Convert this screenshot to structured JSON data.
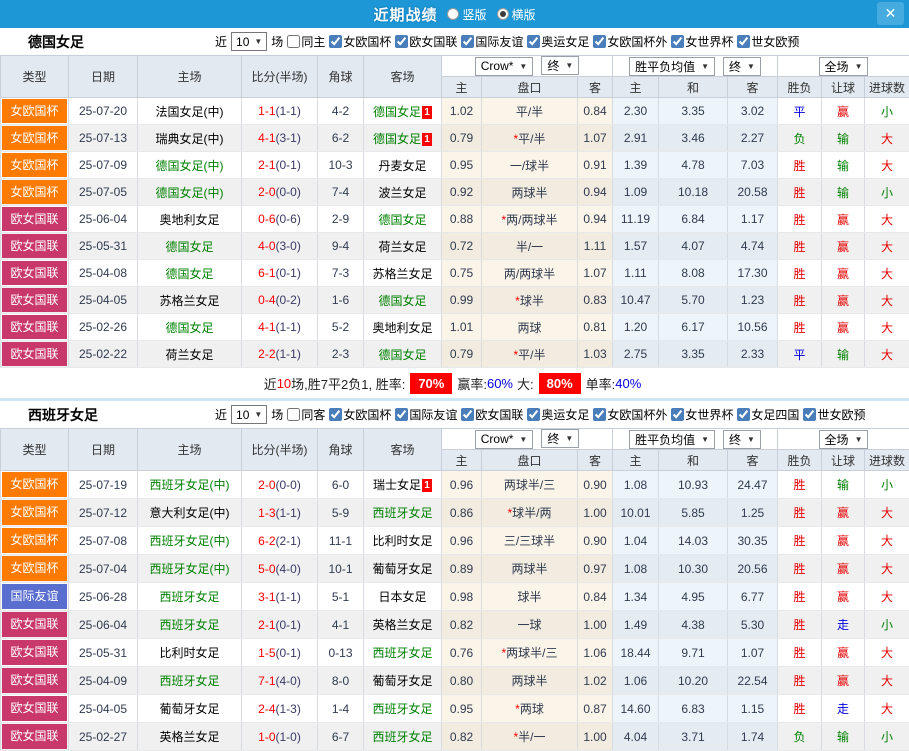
{
  "titlebar": {
    "title": "近期战绩",
    "layout_options": [
      {
        "label": "竖版",
        "selected": false
      },
      {
        "label": "横版",
        "selected": true
      }
    ],
    "close_label": "✕"
  },
  "table_header": {
    "type": "类型",
    "date": "日期",
    "home": "主场",
    "score": "比分(半场)",
    "corner": "角球",
    "away": "客场",
    "odds_company": "Crow*",
    "odds_final": "终",
    "avg_title": "胜平负均值",
    "avg_final": "终",
    "scope": "全场",
    "sub_home": "主",
    "sub_handicap": "盘口",
    "sub_away": "客",
    "sub_avg_home": "主",
    "sub_avg_draw": "和",
    "sub_avg_away": "客",
    "sub_result": "胜负",
    "sub_let": "让球",
    "sub_goals": "进球数"
  },
  "colors": {
    "topbar": "#1E97D6",
    "cup_badge": "#FF7A00",
    "league_badge": "#C9386A",
    "friendly_badge": "#5A6ED0",
    "win_red": "#E60000",
    "draw_blue": "#0000E0",
    "loss_green": "#008000",
    "focus_team_green": "#008000",
    "score_red": "#FF0000",
    "summary_badge_red": "#FF0000"
  },
  "sections": [
    {
      "team": "德国女足",
      "filter": {
        "near": "近",
        "count": "10",
        "games": "场",
        "same_label": "同主",
        "same_checked": false,
        "competitions": [
          "女欧国杯",
          "欧女国联",
          "国际友谊",
          "奥运女足",
          "女欧国杯外",
          "女世界杯",
          "世女欧预"
        ]
      },
      "rows": [
        {
          "type": "女欧国杯",
          "type_class": "cup",
          "date": "25-07-20",
          "home": "法国女足(中)",
          "home_focus": false,
          "score": "1-1",
          "half": "(1-1)",
          "corner": "4-2",
          "away": "德国女足",
          "away_focus": true,
          "away_card": "1",
          "h_odds": "1.02",
          "handicap": "平/半",
          "handicap_star": false,
          "a_odds": "0.84",
          "avg_h": "2.30",
          "avg_d": "3.35",
          "avg_a": "3.02",
          "res_wdl": "平",
          "res_wdl_c": "blue",
          "res_let": "赢",
          "res_let_c": "red",
          "res_goal": "小",
          "res_goal_c": "green"
        },
        {
          "type": "女欧国杯",
          "type_class": "cup",
          "date": "25-07-13",
          "home": "瑞典女足(中)",
          "home_focus": false,
          "score": "4-1",
          "half": "(3-1)",
          "corner": "6-2",
          "away": "德国女足",
          "away_focus": true,
          "away_card": "1",
          "h_odds": "0.79",
          "handicap": "平/半",
          "handicap_star": true,
          "a_odds": "1.07",
          "avg_h": "2.91",
          "avg_d": "3.46",
          "avg_a": "2.27",
          "res_wdl": "负",
          "res_wdl_c": "green",
          "res_let": "输",
          "res_let_c": "green",
          "res_goal": "大",
          "res_goal_c": "red"
        },
        {
          "type": "女欧国杯",
          "type_class": "cup",
          "date": "25-07-09",
          "home": "德国女足(中)",
          "home_focus": true,
          "score": "2-1",
          "half": "(0-1)",
          "corner": "10-3",
          "away": "丹麦女足",
          "away_focus": false,
          "h_odds": "0.95",
          "handicap": "一/球半",
          "handicap_star": false,
          "a_odds": "0.91",
          "avg_h": "1.39",
          "avg_d": "4.78",
          "avg_a": "7.03",
          "res_wdl": "胜",
          "res_wdl_c": "red",
          "res_let": "输",
          "res_let_c": "green",
          "res_goal": "大",
          "res_goal_c": "red"
        },
        {
          "type": "女欧国杯",
          "type_class": "cup",
          "date": "25-07-05",
          "home": "德国女足(中)",
          "home_focus": true,
          "score": "2-0",
          "half": "(0-0)",
          "corner": "7-4",
          "away": "波兰女足",
          "away_focus": false,
          "h_odds": "0.92",
          "handicap": "两球半",
          "handicap_star": false,
          "a_odds": "0.94",
          "avg_h": "1.09",
          "avg_d": "10.18",
          "avg_a": "20.58",
          "res_wdl": "胜",
          "res_wdl_c": "red",
          "res_let": "输",
          "res_let_c": "green",
          "res_goal": "小",
          "res_goal_c": "green"
        },
        {
          "type": "欧女国联",
          "type_class": "league",
          "date": "25-06-04",
          "home": "奥地利女足",
          "home_focus": false,
          "score": "0-6",
          "half": "(0-6)",
          "corner": "2-9",
          "away": "德国女足",
          "away_focus": true,
          "h_odds": "0.88",
          "handicap": "两/两球半",
          "handicap_star": true,
          "a_odds": "0.94",
          "avg_h": "11.19",
          "avg_d": "6.84",
          "avg_a": "1.17",
          "res_wdl": "胜",
          "res_wdl_c": "red",
          "res_let": "赢",
          "res_let_c": "red",
          "res_goal": "大",
          "res_goal_c": "red"
        },
        {
          "type": "欧女国联",
          "type_class": "league",
          "date": "25-05-31",
          "home": "德国女足",
          "home_focus": true,
          "score": "4-0",
          "half": "(3-0)",
          "corner": "9-4",
          "away": "荷兰女足",
          "away_focus": false,
          "h_odds": "0.72",
          "handicap": "半/一",
          "handicap_star": false,
          "a_odds": "1.11",
          "avg_h": "1.57",
          "avg_d": "4.07",
          "avg_a": "4.74",
          "res_wdl": "胜",
          "res_wdl_c": "red",
          "res_let": "赢",
          "res_let_c": "red",
          "res_goal": "大",
          "res_goal_c": "red"
        },
        {
          "type": "欧女国联",
          "type_class": "league",
          "date": "25-04-08",
          "home": "德国女足",
          "home_focus": true,
          "score": "6-1",
          "half": "(0-1)",
          "corner": "7-3",
          "away": "苏格兰女足",
          "away_focus": false,
          "h_odds": "0.75",
          "handicap": "两/两球半",
          "handicap_star": false,
          "a_odds": "1.07",
          "avg_h": "1.11",
          "avg_d": "8.08",
          "avg_a": "17.30",
          "res_wdl": "胜",
          "res_wdl_c": "red",
          "res_let": "赢",
          "res_let_c": "red",
          "res_goal": "大",
          "res_goal_c": "red"
        },
        {
          "type": "欧女国联",
          "type_class": "league",
          "date": "25-04-05",
          "home": "苏格兰女足",
          "home_focus": false,
          "score": "0-4",
          "half": "(0-2)",
          "corner": "1-6",
          "away": "德国女足",
          "away_focus": true,
          "h_odds": "0.99",
          "handicap": "球半",
          "handicap_star": true,
          "a_odds": "0.83",
          "avg_h": "10.47",
          "avg_d": "5.70",
          "avg_a": "1.23",
          "res_wdl": "胜",
          "res_wdl_c": "red",
          "res_let": "赢",
          "res_let_c": "red",
          "res_goal": "大",
          "res_goal_c": "red"
        },
        {
          "type": "欧女国联",
          "type_class": "league",
          "date": "25-02-26",
          "home": "德国女足",
          "home_focus": true,
          "score": "4-1",
          "half": "(1-1)",
          "corner": "5-2",
          "away": "奥地利女足",
          "away_focus": false,
          "h_odds": "1.01",
          "handicap": "两球",
          "handicap_star": false,
          "a_odds": "0.81",
          "avg_h": "1.20",
          "avg_d": "6.17",
          "avg_a": "10.56",
          "res_wdl": "胜",
          "res_wdl_c": "red",
          "res_let": "赢",
          "res_let_c": "red",
          "res_goal": "大",
          "res_goal_c": "red"
        },
        {
          "type": "欧女国联",
          "type_class": "league",
          "date": "25-02-22",
          "home": "荷兰女足",
          "home_focus": false,
          "score": "2-2",
          "half": "(1-1)",
          "corner": "2-3",
          "away": "德国女足",
          "away_focus": true,
          "h_odds": "0.79",
          "handicap": "平/半",
          "handicap_star": true,
          "a_odds": "1.03",
          "avg_h": "2.75",
          "avg_d": "3.35",
          "avg_a": "2.33",
          "res_wdl": "平",
          "res_wdl_c": "blue",
          "res_let": "输",
          "res_let_c": "green",
          "res_goal": "大",
          "res_goal_c": "red"
        }
      ],
      "summary": [
        {
          "text": "近",
          "style": "plain"
        },
        {
          "text": "10",
          "style": "red"
        },
        {
          "text": "场,胜7平2负1, 胜率:",
          "style": "plain"
        },
        {
          "text": "70%",
          "style": "badge"
        },
        {
          "text": "赢率:",
          "style": "plain"
        },
        {
          "text": "60%",
          "style": "blue"
        },
        {
          "text": "大:",
          "style": "plain"
        },
        {
          "text": "80%",
          "style": "badge"
        },
        {
          "text": "单率:",
          "style": "plain"
        },
        {
          "text": "40%",
          "style": "blue"
        }
      ]
    },
    {
      "team": "西班牙女足",
      "filter": {
        "near": "近",
        "count": "10",
        "games": "场",
        "same_label": "同客",
        "same_checked": false,
        "competitions": [
          "女欧国杯",
          "国际友谊",
          "欧女国联",
          "奥运女足",
          "女欧国杯外",
          "女世界杯",
          "女足四国",
          "世女欧预"
        ]
      },
      "rows": [
        {
          "type": "女欧国杯",
          "type_class": "cup",
          "date": "25-07-19",
          "home": "西班牙女足(中)",
          "home_focus": true,
          "score": "2-0",
          "half": "(0-0)",
          "corner": "6-0",
          "away": "瑞士女足",
          "away_focus": false,
          "away_card": "1",
          "h_odds": "0.96",
          "handicap": "两球半/三",
          "handicap_star": false,
          "a_odds": "0.90",
          "avg_h": "1.08",
          "avg_d": "10.93",
          "avg_a": "24.47",
          "res_wdl": "胜",
          "res_wdl_c": "red",
          "res_let": "输",
          "res_let_c": "green",
          "res_goal": "小",
          "res_goal_c": "green"
        },
        {
          "type": "女欧国杯",
          "type_class": "cup",
          "date": "25-07-12",
          "home": "意大利女足(中)",
          "home_focus": false,
          "score": "1-3",
          "half": "(1-1)",
          "corner": "5-9",
          "away": "西班牙女足",
          "away_focus": true,
          "h_odds": "0.86",
          "handicap": "球半/两",
          "handicap_star": true,
          "a_odds": "1.00",
          "avg_h": "10.01",
          "avg_d": "5.85",
          "avg_a": "1.25",
          "res_wdl": "胜",
          "res_wdl_c": "red",
          "res_let": "赢",
          "res_let_c": "red",
          "res_goal": "大",
          "res_goal_c": "red"
        },
        {
          "type": "女欧国杯",
          "type_class": "cup",
          "date": "25-07-08",
          "home": "西班牙女足(中)",
          "home_focus": true,
          "score": "6-2",
          "half": "(2-1)",
          "corner": "11-1",
          "away": "比利时女足",
          "away_focus": false,
          "h_odds": "0.96",
          "handicap": "三/三球半",
          "handicap_star": false,
          "a_odds": "0.90",
          "avg_h": "1.04",
          "avg_d": "14.03",
          "avg_a": "30.35",
          "res_wdl": "胜",
          "res_wdl_c": "red",
          "res_let": "赢",
          "res_let_c": "red",
          "res_goal": "大",
          "res_goal_c": "red"
        },
        {
          "type": "女欧国杯",
          "type_class": "cup",
          "date": "25-07-04",
          "home": "西班牙女足(中)",
          "home_focus": true,
          "score": "5-0",
          "half": "(4-0)",
          "corner": "10-1",
          "away": "葡萄牙女足",
          "away_focus": false,
          "h_odds": "0.89",
          "handicap": "两球半",
          "handicap_star": false,
          "a_odds": "0.97",
          "avg_h": "1.08",
          "avg_d": "10.30",
          "avg_a": "20.56",
          "res_wdl": "胜",
          "res_wdl_c": "red",
          "res_let": "赢",
          "res_let_c": "red",
          "res_goal": "大",
          "res_goal_c": "red"
        },
        {
          "type": "国际友谊",
          "type_class": "friendly",
          "date": "25-06-28",
          "home": "西班牙女足",
          "home_focus": true,
          "score": "3-1",
          "half": "(1-1)",
          "corner": "5-1",
          "away": "日本女足",
          "away_focus": false,
          "h_odds": "0.98",
          "handicap": "球半",
          "handicap_star": false,
          "a_odds": "0.84",
          "avg_h": "1.34",
          "avg_d": "4.95",
          "avg_a": "6.77",
          "res_wdl": "胜",
          "res_wdl_c": "red",
          "res_let": "赢",
          "res_let_c": "red",
          "res_goal": "大",
          "res_goal_c": "red"
        },
        {
          "type": "欧女国联",
          "type_class": "league",
          "date": "25-06-04",
          "home": "西班牙女足",
          "home_focus": true,
          "score": "2-1",
          "half": "(0-1)",
          "corner": "4-1",
          "away": "英格兰女足",
          "away_focus": false,
          "h_odds": "0.82",
          "handicap": "一球",
          "handicap_star": false,
          "a_odds": "1.00",
          "avg_h": "1.49",
          "avg_d": "4.38",
          "avg_a": "5.30",
          "res_wdl": "胜",
          "res_wdl_c": "red",
          "res_let": "走",
          "res_let_c": "blue",
          "res_goal": "小",
          "res_goal_c": "green"
        },
        {
          "type": "欧女国联",
          "type_class": "league",
          "date": "25-05-31",
          "home": "比利时女足",
          "home_focus": false,
          "score": "1-5",
          "half": "(0-1)",
          "corner": "0-13",
          "away": "西班牙女足",
          "away_focus": true,
          "h_odds": "0.76",
          "handicap": "两球半/三",
          "handicap_star": true,
          "a_odds": "1.06",
          "avg_h": "18.44",
          "avg_d": "9.71",
          "avg_a": "1.07",
          "res_wdl": "胜",
          "res_wdl_c": "red",
          "res_let": "赢",
          "res_let_c": "red",
          "res_goal": "大",
          "res_goal_c": "red"
        },
        {
          "type": "欧女国联",
          "type_class": "league",
          "date": "25-04-09",
          "home": "西班牙女足",
          "home_focus": true,
          "score": "7-1",
          "half": "(4-0)",
          "corner": "8-0",
          "away": "葡萄牙女足",
          "away_focus": false,
          "h_odds": "0.80",
          "handicap": "两球半",
          "handicap_star": false,
          "a_odds": "1.02",
          "avg_h": "1.06",
          "avg_d": "10.20",
          "avg_a": "22.54",
          "res_wdl": "胜",
          "res_wdl_c": "red",
          "res_let": "赢",
          "res_let_c": "red",
          "res_goal": "大",
          "res_goal_c": "red"
        },
        {
          "type": "欧女国联",
          "type_class": "league",
          "date": "25-04-05",
          "home": "葡萄牙女足",
          "home_focus": false,
          "score": "2-4",
          "half": "(1-3)",
          "corner": "1-4",
          "away": "西班牙女足",
          "away_focus": true,
          "h_odds": "0.95",
          "handicap": "两球",
          "handicap_star": true,
          "a_odds": "0.87",
          "avg_h": "14.60",
          "avg_d": "6.83",
          "avg_a": "1.15",
          "res_wdl": "胜",
          "res_wdl_c": "red",
          "res_let": "走",
          "res_let_c": "blue",
          "res_goal": "大",
          "res_goal_c": "red"
        },
        {
          "type": "欧女国联",
          "type_class": "league",
          "date": "25-02-27",
          "home": "英格兰女足",
          "home_focus": false,
          "score": "1-0",
          "half": "(1-0)",
          "corner": "6-7",
          "away": "西班牙女足",
          "away_focus": true,
          "h_odds": "0.82",
          "handicap": "半/一",
          "handicap_star": true,
          "a_odds": "1.00",
          "avg_h": "4.04",
          "avg_d": "3.71",
          "avg_a": "1.74",
          "res_wdl": "负",
          "res_wdl_c": "green",
          "res_let": "输",
          "res_let_c": "green",
          "res_goal": "小",
          "res_goal_c": "green"
        }
      ]
    }
  ]
}
